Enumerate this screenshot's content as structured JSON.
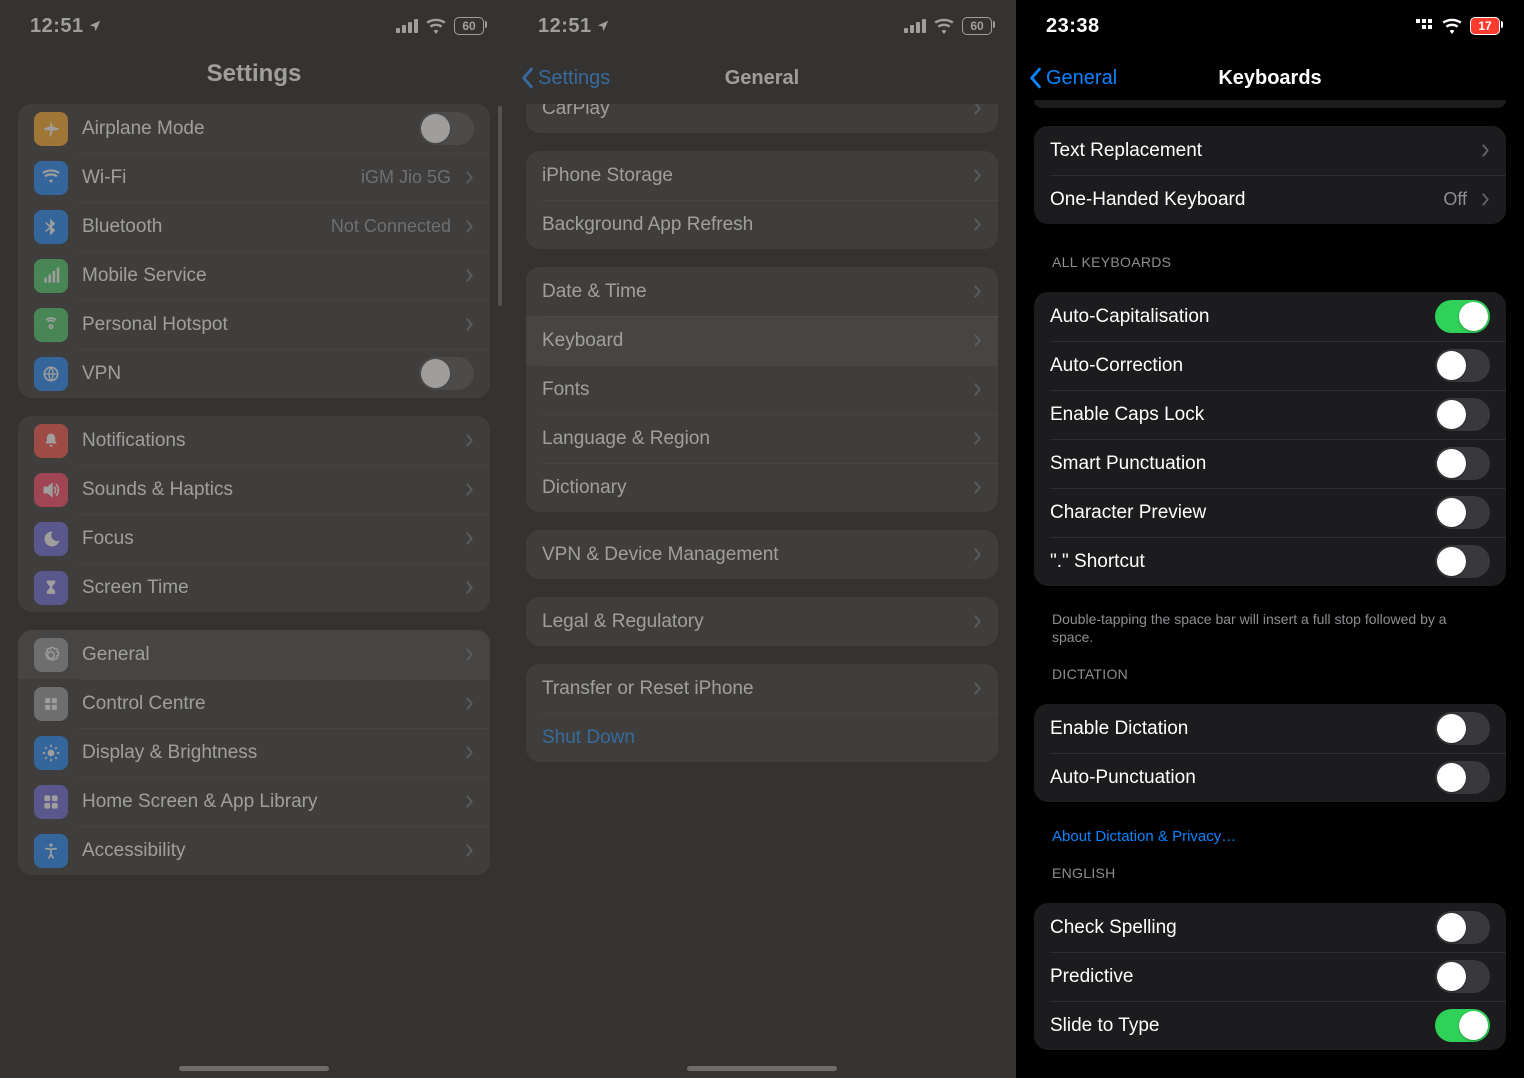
{
  "screen1": {
    "status": {
      "time": "12:51",
      "battery": "60"
    },
    "title": "Settings",
    "groups": [
      {
        "rows": [
          {
            "icon": "airplane-icon",
            "bg": "bg-orange",
            "label": "Airplane Mode",
            "type": "toggle",
            "on": false
          },
          {
            "icon": "wifi-icon",
            "bg": "bg-blue",
            "label": "Wi-Fi",
            "value": "iGM Jio 5G",
            "type": "disclosure"
          },
          {
            "icon": "bluetooth-icon",
            "bg": "bg-blue",
            "label": "Bluetooth",
            "value": "Not Connected",
            "type": "disclosure"
          },
          {
            "icon": "cellular-icon",
            "bg": "bg-green",
            "label": "Mobile Service",
            "type": "disclosure"
          },
          {
            "icon": "hotspot-icon",
            "bg": "bg-green",
            "label": "Personal Hotspot",
            "type": "disclosure"
          },
          {
            "icon": "vpn-icon",
            "bg": "bg-blue",
            "label": "VPN",
            "type": "toggle",
            "on": false
          }
        ]
      },
      {
        "rows": [
          {
            "icon": "bell-icon",
            "bg": "bg-red",
            "label": "Notifications",
            "type": "disclosure"
          },
          {
            "icon": "sound-icon",
            "bg": "bg-pink",
            "label": "Sounds & Haptics",
            "type": "disclosure"
          },
          {
            "icon": "moon-icon",
            "bg": "bg-indigo",
            "label": "Focus",
            "type": "disclosure"
          },
          {
            "icon": "hourglass-icon",
            "bg": "bg-indigo",
            "label": "Screen Time",
            "type": "disclosure"
          }
        ]
      },
      {
        "rows": [
          {
            "icon": "gear-icon",
            "bg": "bg-gray",
            "label": "General",
            "type": "disclosure",
            "highlight": true
          },
          {
            "icon": "control-icon",
            "bg": "bg-gray",
            "label": "Control Centre",
            "type": "disclosure"
          },
          {
            "icon": "brightness-icon",
            "bg": "bg-blue",
            "label": "Display & Brightness",
            "type": "disclosure"
          },
          {
            "icon": "home-icon",
            "bg": "bg-indigo",
            "label": "Home Screen & App Library",
            "type": "disclosure"
          },
          {
            "icon": "accessibility-icon",
            "bg": "bg-blue",
            "label": "Accessibility",
            "type": "disclosure"
          }
        ]
      }
    ]
  },
  "screen2": {
    "status": {
      "time": "12:51",
      "battery": "60"
    },
    "back": "Settings",
    "title": "General",
    "groups": [
      {
        "cutTop": true,
        "rows": [
          {
            "label": "CarPlay",
            "type": "disclosure"
          }
        ]
      },
      {
        "rows": [
          {
            "label": "iPhone Storage",
            "type": "disclosure"
          },
          {
            "label": "Background App Refresh",
            "type": "disclosure"
          }
        ]
      },
      {
        "rows": [
          {
            "label": "Date & Time",
            "type": "disclosure"
          },
          {
            "label": "Keyboard",
            "type": "disclosure",
            "highlight": true
          },
          {
            "label": "Fonts",
            "type": "disclosure"
          },
          {
            "label": "Language & Region",
            "type": "disclosure"
          },
          {
            "label": "Dictionary",
            "type": "disclosure"
          }
        ]
      },
      {
        "rows": [
          {
            "label": "VPN & Device Management",
            "type": "disclosure"
          }
        ]
      },
      {
        "rows": [
          {
            "label": "Legal & Regulatory",
            "type": "disclosure"
          }
        ]
      },
      {
        "rows": [
          {
            "label": "Transfer or Reset iPhone",
            "type": "disclosure"
          },
          {
            "label": "Shut Down",
            "type": "link"
          }
        ]
      }
    ]
  },
  "screen3": {
    "status": {
      "time": "23:38",
      "battery": "17"
    },
    "back": "General",
    "title": "Keyboards",
    "groups": [
      {
        "header": null,
        "rows": [
          {
            "label": "Text Replacement",
            "type": "disclosure"
          },
          {
            "label": "One-Handed Keyboard",
            "value": "Off",
            "type": "disclosure"
          }
        ]
      },
      {
        "header": "ALL KEYBOARDS",
        "rows": [
          {
            "label": "Auto-Capitalisation",
            "type": "toggle",
            "on": true
          },
          {
            "label": "Auto-Correction",
            "type": "toggle",
            "on": false
          },
          {
            "label": "Enable Caps Lock",
            "type": "toggle",
            "on": false
          },
          {
            "label": "Smart Punctuation",
            "type": "toggle",
            "on": false
          },
          {
            "label": "Character Preview",
            "type": "toggle",
            "on": false
          },
          {
            "label": "\".\" Shortcut",
            "type": "toggle",
            "on": false
          }
        ],
        "footer": "Double-tapping the space bar will insert a full stop followed by a space."
      },
      {
        "header": "DICTATION",
        "rows": [
          {
            "label": "Enable Dictation",
            "type": "toggle",
            "on": false
          },
          {
            "label": "Auto-Punctuation",
            "type": "toggle",
            "on": false
          }
        ],
        "link": "About Dictation & Privacy…"
      },
      {
        "header": "ENGLISH",
        "rows": [
          {
            "label": "Check Spelling",
            "type": "toggle",
            "on": false
          },
          {
            "label": "Predictive",
            "type": "toggle",
            "on": false
          },
          {
            "label": "Slide to Type",
            "type": "toggle",
            "on": true
          }
        ]
      }
    ]
  }
}
